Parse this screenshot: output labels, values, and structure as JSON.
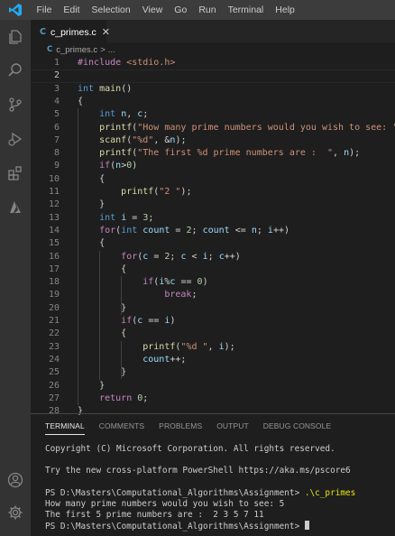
{
  "menubar": {
    "items": [
      "File",
      "Edit",
      "Selection",
      "View",
      "Go",
      "Run",
      "Terminal",
      "Help"
    ]
  },
  "colors": {
    "accent": "#007acc",
    "menubar_bg": "#3c3c3c",
    "activity_bg": "#333333",
    "editor_bg": "#1e1e1e"
  },
  "activity_bar": {
    "icons": [
      "explorer-icon",
      "search-icon",
      "source-control-icon",
      "run-debug-icon",
      "extensions-icon",
      "azure-icon",
      "account-icon",
      "settings-gear-icon"
    ]
  },
  "tab": {
    "icon_text": "C",
    "label": "c_primes.c",
    "close": "✕"
  },
  "breadcrumb": {
    "icon_text": "C",
    "file": "c_primes.c",
    "separator": ">",
    "rest": "..."
  },
  "editor": {
    "lines": [
      {
        "n": "1",
        "text": "#include <stdio.h>"
      },
      {
        "n": "2",
        "text": ""
      },
      {
        "n": "3",
        "text": "int main()"
      },
      {
        "n": "4",
        "text": "{"
      },
      {
        "n": "5",
        "text": "    int n, c;"
      },
      {
        "n": "6",
        "text": "    printf(\"How many prime numbers would you wish to see: \");"
      },
      {
        "n": "7",
        "text": "    scanf(\"%d\", &n);"
      },
      {
        "n": "8",
        "text": "    printf(\"The first %d prime numbers are :  \", n);"
      },
      {
        "n": "9",
        "text": "    if(n>0)"
      },
      {
        "n": "10",
        "text": "    {"
      },
      {
        "n": "11",
        "text": "        printf(\"2 \");"
      },
      {
        "n": "12",
        "text": "    }"
      },
      {
        "n": "13",
        "text": "    int i = 3;"
      },
      {
        "n": "14",
        "text": "    for(int count = 2; count <= n; i++)"
      },
      {
        "n": "15",
        "text": "    {"
      },
      {
        "n": "16",
        "text": "        for(c = 2; c < i; c++)"
      },
      {
        "n": "17",
        "text": "        {"
      },
      {
        "n": "18",
        "text": "            if(i%c == 0)"
      },
      {
        "n": "19",
        "text": "                break;"
      },
      {
        "n": "20",
        "text": "        }"
      },
      {
        "n": "21",
        "text": "        if(c == i)"
      },
      {
        "n": "22",
        "text": "        {"
      },
      {
        "n": "23",
        "text": "            printf(\"%d \", i);"
      },
      {
        "n": "24",
        "text": "            count++;"
      },
      {
        "n": "25",
        "text": "        }"
      },
      {
        "n": "26",
        "text": "    }"
      },
      {
        "n": "27",
        "text": "    return 0;"
      },
      {
        "n": "28",
        "text": "}"
      }
    ]
  },
  "panel": {
    "tabs": [
      "TERMINAL",
      "COMMENTS",
      "PROBLEMS",
      "OUTPUT",
      "DEBUG CONSOLE"
    ]
  },
  "terminal": {
    "copyright": "Copyright (C) Microsoft Corporation. All rights reserved.",
    "try_line": "Try the new cross-platform PowerShell https://aka.ms/pscore6",
    "prompt1": "PS D:\\Masters\\Computational_Algorithms\\Assignment> ",
    "command1": ".\\c_primes",
    "output1": "How many prime numbers would you wish to see: 5",
    "output2": "The first 5 prime numbers are :  2 3 5 7 11",
    "prompt2": "PS D:\\Masters\\Computational_Algorithms\\Assignment> "
  }
}
